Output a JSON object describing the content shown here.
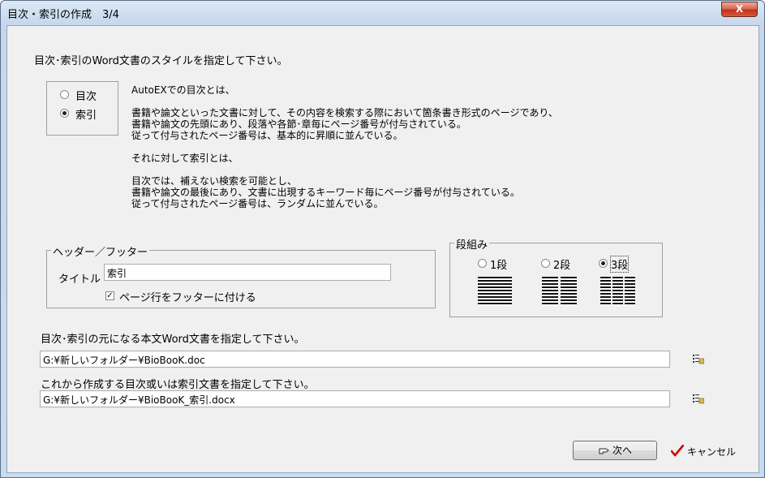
{
  "window": {
    "title": "目次・索引の作成　3/4",
    "close_label": "X"
  },
  "instruction": "目次･索引のWord文書のスタイルを指定して下さい。",
  "doc_type": {
    "options": [
      {
        "label": "目次",
        "selected": false
      },
      {
        "label": "索引",
        "selected": true
      }
    ]
  },
  "description": {
    "lines": [
      "AutoEXでの目次とは、",
      "",
      "書籍や論文といった文書に対して、その内容を検索する際において箇条書き形式のページであり、",
      "書籍や論文の先頭にあり、段落や各節･章毎にページ番号が付与されている。",
      "従って付与されたページ番号は、基本的に昇順に並んでいる。",
      "",
      "それに対して索引とは、",
      "",
      "目次では、補えない検索を可能とし、",
      "書籍や論文の最後にあり、文書に出現するキーワード毎にページ番号が付与されている。",
      "従って付与されたページ番号は、ランダムに並んでいる。"
    ]
  },
  "header_footer": {
    "group_title": "ヘッダー／フッター",
    "title_label": "タイトル",
    "title_value": "索引",
    "footer_checkbox_label": "ページ行をフッターに付ける",
    "footer_checked": true
  },
  "columns": {
    "group_title": "段組み",
    "options": [
      {
        "label": "1段",
        "selected": false,
        "count": 1
      },
      {
        "label": "2段",
        "selected": false,
        "count": 2
      },
      {
        "label": "3段",
        "selected": true,
        "count": 3
      }
    ]
  },
  "source": {
    "label": "目次･索引の元になる本文Word文書を指定して下さい。",
    "path": "G:¥新しいフォルダー¥BioBooK.doc",
    "browse_icon": "folder-browse-icon"
  },
  "output": {
    "label": "これから作成する目次或いは索引文書を指定して下さい。",
    "path": "G:¥新しいフォルダー¥BioBooK_索引.docx",
    "browse_icon": "folder-browse-icon"
  },
  "buttons": {
    "next": "次へ",
    "cancel": "キャンセル"
  }
}
